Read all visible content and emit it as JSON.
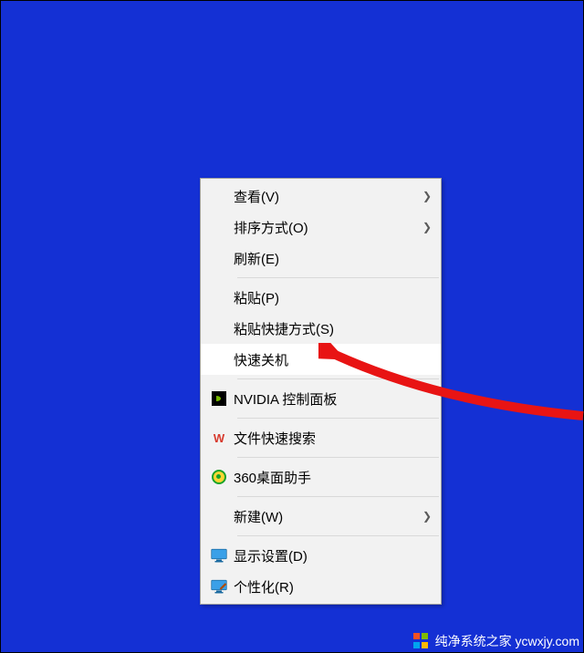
{
  "menu": {
    "items": [
      {
        "label": "查看(V)",
        "submenu": true,
        "icon": null
      },
      {
        "label": "排序方式(O)",
        "submenu": true,
        "icon": null
      },
      {
        "label": "刷新(E)",
        "submenu": false,
        "icon": null
      },
      {
        "sep": true
      },
      {
        "label": "粘贴(P)",
        "submenu": false,
        "icon": null
      },
      {
        "label": "粘贴快捷方式(S)",
        "submenu": false,
        "icon": null
      },
      {
        "label": "快速关机",
        "submenu": false,
        "icon": null,
        "highlight": true
      },
      {
        "sep": true
      },
      {
        "label": "NVIDIA 控制面板",
        "submenu": false,
        "icon": "nvidia"
      },
      {
        "sep": true
      },
      {
        "label": "文件快速搜索",
        "submenu": false,
        "icon": "wps"
      },
      {
        "sep": true
      },
      {
        "label": "360桌面助手",
        "submenu": false,
        "icon": "360"
      },
      {
        "sep": true
      },
      {
        "label": "新建(W)",
        "submenu": true,
        "icon": null
      },
      {
        "sep": true
      },
      {
        "label": "显示设置(D)",
        "submenu": false,
        "icon": "monitor"
      },
      {
        "label": "个性化(R)",
        "submenu": false,
        "icon": "personalize"
      }
    ]
  },
  "watermark": {
    "text": "纯净系统之家 ycwxjy.com"
  }
}
